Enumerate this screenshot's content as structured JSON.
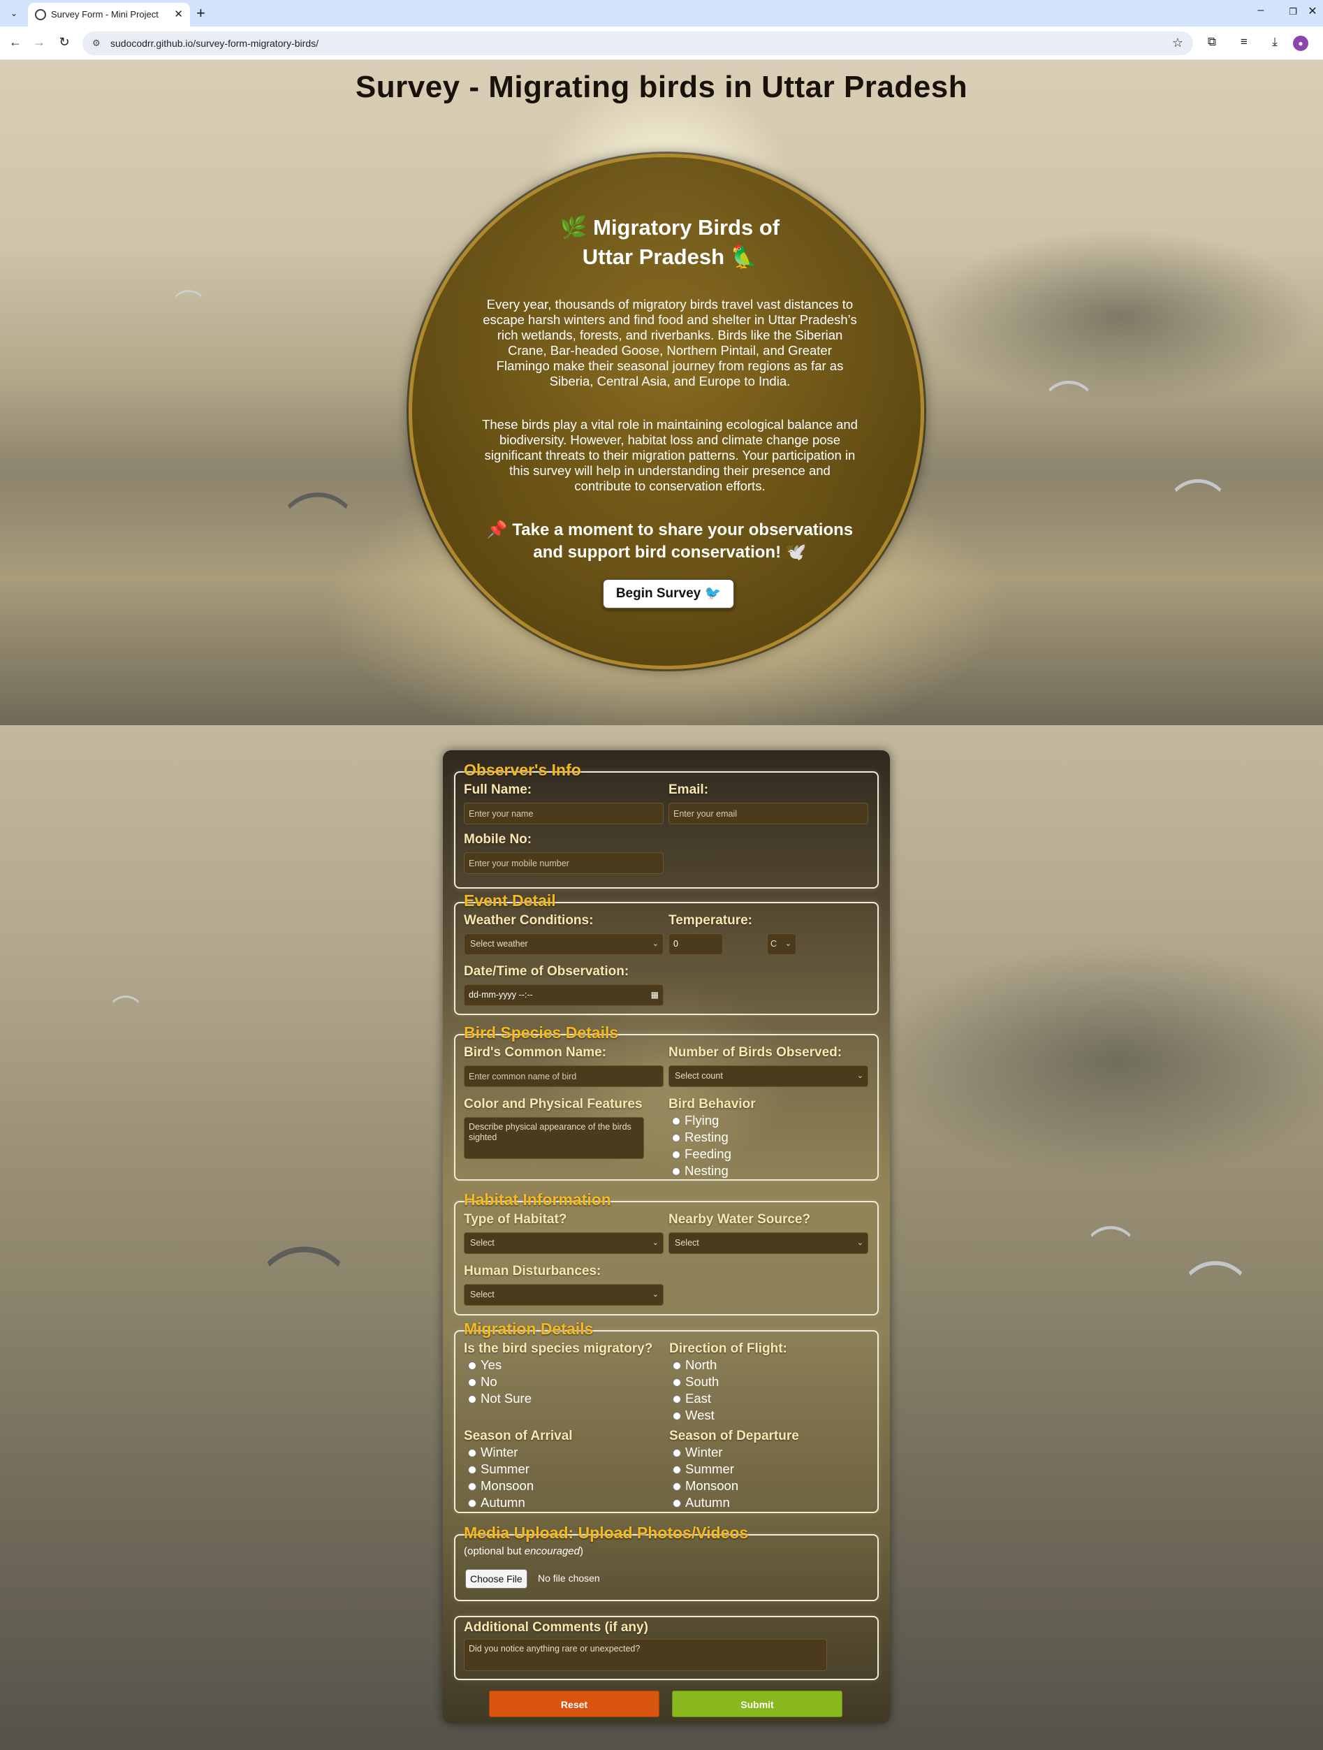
{
  "browser": {
    "tab_title": "Survey Form - Mini Project",
    "url": "sudocodrr.github.io/survey-form-migratory-birds/"
  },
  "hero": {
    "page_title": "Survey - Migrating birds in Uttar Pradesh",
    "title_line1": "🌿 Migratory Birds of",
    "title_line2": "Uttar Pradesh 🦜",
    "para1": "Every year, thousands of migratory birds travel vast distances to escape harsh winters and find food and shelter in Uttar Pradesh’s rich wetlands, forests, and riverbanks. Birds like the Siberian Crane, Bar-headed Goose, Northern Pintail, and Greater Flamingo make their seasonal journey from regions as far as Siberia, Central Asia, and Europe to India.",
    "para2": "These birds play a vital role in maintaining ecological balance and biodiversity. However, habitat loss and climate change pose significant threats to their migration patterns. Your participation in this survey will help in understanding their presence and contribute to conservation efforts.",
    "cta": "📌 Take a moment to share your observations and support bird conservation! 🕊️",
    "begin_button": "Begin Survey 🐦"
  },
  "observer": {
    "legend": "Observer's Info",
    "name_label": "Full Name:",
    "name_placeholder": "Enter your name",
    "email_label": "Email:",
    "email_placeholder": "Enter your email",
    "mobile_label": "Mobile No:",
    "mobile_placeholder": "Enter your mobile number"
  },
  "event": {
    "legend": "Event Detail",
    "weather_label": "Weather Conditions:",
    "weather_value": "Select weather",
    "temp_label": "Temperature:",
    "temp_value": "0",
    "temp_unit": "C",
    "datetime_label": "Date/Time of Observation:",
    "datetime_value": "dd-mm-yyyy --:--"
  },
  "species": {
    "legend": "Bird Species Details",
    "common_name_label": "Bird's Common Name:",
    "common_name_placeholder": "Enter common name of bird",
    "count_label": "Number of Birds Observed:",
    "count_value": "Select count",
    "features_label": "Color and Physical Features",
    "features_placeholder": "Describe physical appearance of the birds sighted",
    "behavior_label": "Bird Behavior",
    "behaviors": [
      "Flying",
      "Resting",
      "Feeding",
      "Nesting"
    ]
  },
  "habitat": {
    "legend": "Habitat Information",
    "type_label": "Type of Habitat?",
    "type_value": "Select",
    "water_label": "Nearby Water Source?",
    "water_value": "Select",
    "disturb_label": "Human Disturbances:",
    "disturb_value": "Select"
  },
  "migration": {
    "legend": "Migration Details",
    "migratory_label": "Is the bird species migratory?",
    "migratory_options": [
      "Yes",
      "No",
      "Not Sure"
    ],
    "direction_label": "Direction of Flight:",
    "direction_options": [
      "North",
      "South",
      "East",
      "West"
    ],
    "arrival_label": "Season of Arrival",
    "arrival_options": [
      "Winter",
      "Summer",
      "Monsoon",
      "Autumn"
    ],
    "departure_label": "Season of Departure",
    "departure_options": [
      "Winter",
      "Summer",
      "Monsoon",
      "Autumn"
    ]
  },
  "media": {
    "legend": "Media Upload: Upload Photos/Videos",
    "note_prefix": "(optional but ",
    "note_em": "encouraged",
    "note_suffix": ")",
    "choose_button": "Choose File",
    "file_status": "No file chosen"
  },
  "comments": {
    "legend": "Additional Comments (if any)",
    "placeholder": "Did you notice anything rare or unexpected?"
  },
  "actions": {
    "reset": "Reset",
    "submit": "Submit",
    "reset_color": "#d9540f",
    "submit_color": "#88b81e"
  }
}
